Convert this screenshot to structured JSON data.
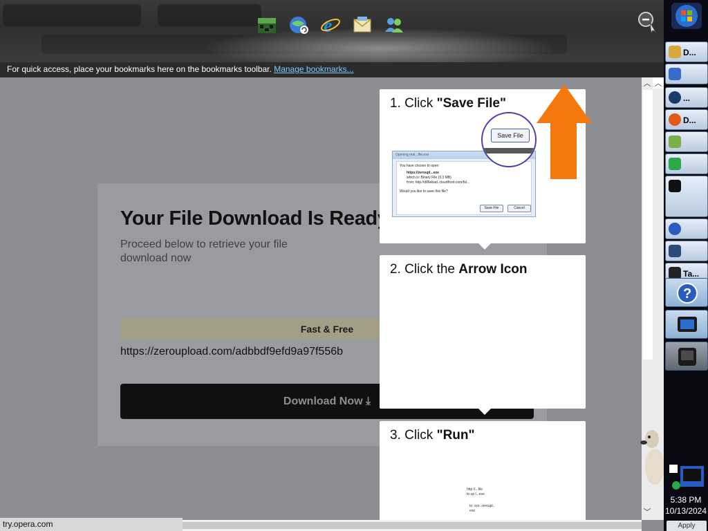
{
  "bookmarks_bar": {
    "message": "For quick access, place your bookmarks here on the bookmarks toolbar.",
    "manage_link": "Manage bookmarks..."
  },
  "quick_launch": [
    "minecraft-icon",
    "globe-refresh-icon",
    "internet-explorer-icon",
    "mail-icon",
    "users-icon"
  ],
  "page": {
    "title": "Your File Download Is Ready",
    "subtitle": "Proceed below to retrieve your file download now",
    "badge": "Fast & Free",
    "url": "https://zeroupload.com/adbbdf9efd9a97f556b",
    "download_button": "Download Now"
  },
  "instructions": {
    "step1": {
      "number": "1. Click ",
      "action": "\"Save File\""
    },
    "step2": {
      "number": "2. Click the ",
      "action": "Arrow Icon"
    },
    "step3": {
      "number": "3. Click ",
      "action": "\"Run\""
    },
    "dialog": {
      "title": "Opening mal...file.exe",
      "line1": "You have chosen to open",
      "line2": "https://zeroupl...exe",
      "line3": "which is: Binary File (3.3 MB)",
      "line4": "from: http://d86ebad..cloudfront.com/fst...",
      "line5": "Would you like to save this file?",
      "save": "Save File",
      "cancel": "Cancel"
    },
    "magnified_button": "Save File",
    "run_line1": "http://...file",
    "run_line2": "to up l...exe",
    "run_line3": "to: xxx. zeroupl...",
    "run_line4": "exe"
  },
  "taskbar": {
    "items": [
      {
        "label": "D...",
        "color": "#d9a73b"
      },
      {
        "label": "",
        "color": "#3a6bc8"
      },
      {
        "label": "...",
        "color": "#1a3a6a"
      },
      {
        "label": "D...",
        "color": "#e05a1a"
      },
      {
        "label": "",
        "color": "#7ab04a"
      },
      {
        "label": "",
        "color": "#2aa84a"
      },
      {
        "label": "",
        "color": "#111111"
      },
      {
        "label": "",
        "color": "#2a5bbf"
      },
      {
        "label": "",
        "color": "#2a4a7a"
      },
      {
        "label": "Ta...",
        "color": "#222222"
      }
    ],
    "time": "5:38 PM",
    "date": "10/13/2024",
    "apply": "Apply"
  },
  "status_bar": {
    "text": "try.opera.com"
  },
  "colors": {
    "orange_arrow": "#f5780f",
    "panel": "#ffffff",
    "accent_link": "#7ec8ff"
  }
}
